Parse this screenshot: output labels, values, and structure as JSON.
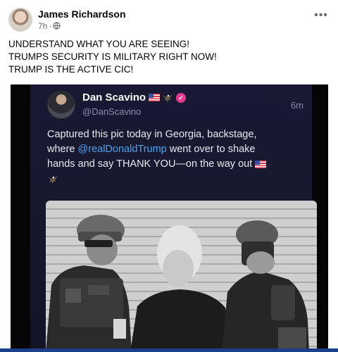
{
  "post": {
    "author": "James Richardson",
    "time": "7h",
    "lines": [
      "UNDERSTAND WHAT YOU ARE SEEING!",
      "TRUMPS SECURITY IS MILITARY RIGHT NOW!",
      "TRUMP IS THE ACTIVE CIC!"
    ],
    "more_label": "•••"
  },
  "tweet": {
    "name": "Dan Scavino",
    "handle": "@DanScavino",
    "time": "6m",
    "verified_glyph": "✓",
    "text_line1": "Captured this pic today in Georgia, backstage,",
    "text_line2_pre": "where ",
    "mention": "@realDonaldTrump",
    "text_line2_post": " went over to shake",
    "text_line3": "hands and say THANK YOU—on the way out"
  },
  "icons": {
    "globe": "globe-icon",
    "flag": "us-flag-icon",
    "eagle": "eagle-icon",
    "verified": "verified-badge-icon"
  },
  "colors": {
    "tweet_bg": "#191933",
    "mention": "#4aa3ef",
    "verified": "#e23a8c",
    "accent_bar": "#1b3e8a"
  }
}
